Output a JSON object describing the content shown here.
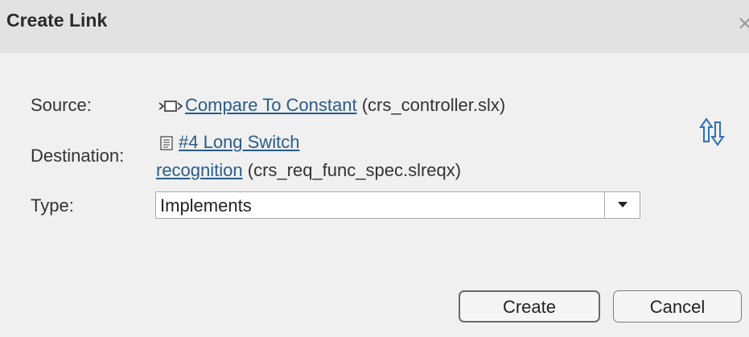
{
  "window": {
    "title": "Create Link",
    "close_icon": "close-icon"
  },
  "source": {
    "label": "Source:",
    "icon": "block-icon",
    "link_text": "Compare To Constant",
    "file": "(crs_controller.slx)"
  },
  "destination": {
    "label": "Destination:",
    "icon": "requirement-doc-icon",
    "link_text_line1": "#4 Long Switch",
    "link_text_line2": "recognition",
    "file": "(crs_req_func_spec.slreqx)"
  },
  "swap": {
    "icon": "swap-arrows-icon"
  },
  "type": {
    "label": "Type:",
    "selected": "Implements"
  },
  "buttons": {
    "create": "Create",
    "cancel": "Cancel"
  },
  "colors": {
    "link": "#2a5c8c",
    "swap_icon": "#2f6fb5",
    "background": "#f0f0f0",
    "titlebar": "#e2e2e2"
  }
}
